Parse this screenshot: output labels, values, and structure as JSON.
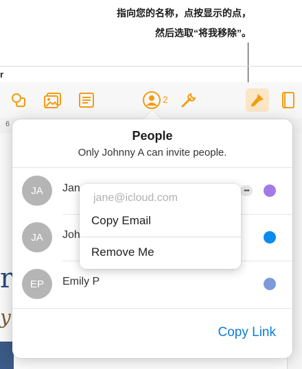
{
  "callout": {
    "line1": "指向您的名称，点按显示的点，",
    "line2": "然后选取“将我移除”。"
  },
  "app": {
    "truncated_label": "r",
    "ruler_number": "6",
    "doc_text_fragment": "r",
    "doc_italic_fragment": "y"
  },
  "toolbar": {
    "icons": [
      "shapes-icon",
      "media-icon",
      "comment-icon",
      "collaborate-icon",
      "wrench-icon",
      "format-brush-icon",
      "document-icon"
    ],
    "collaborator_count": "2",
    "accent_color": "#f39c12"
  },
  "popover": {
    "title": "People",
    "subtitle": "Only Johnny A can invite people.",
    "people": [
      {
        "initials": "JA",
        "name": "Jan",
        "color": "#a27be6"
      },
      {
        "initials": "JA",
        "name": "Joh",
        "color": "#0a8bf0"
      },
      {
        "initials": "EP",
        "name": "Emily P",
        "color": "#7f9ad8"
      }
    ],
    "copy_link_label": "Copy Link",
    "link_color": "#0a7cd9"
  },
  "menu": {
    "email": "jane@icloud.com",
    "copy_email_label": "Copy Email",
    "remove_me_label": "Remove Me"
  }
}
